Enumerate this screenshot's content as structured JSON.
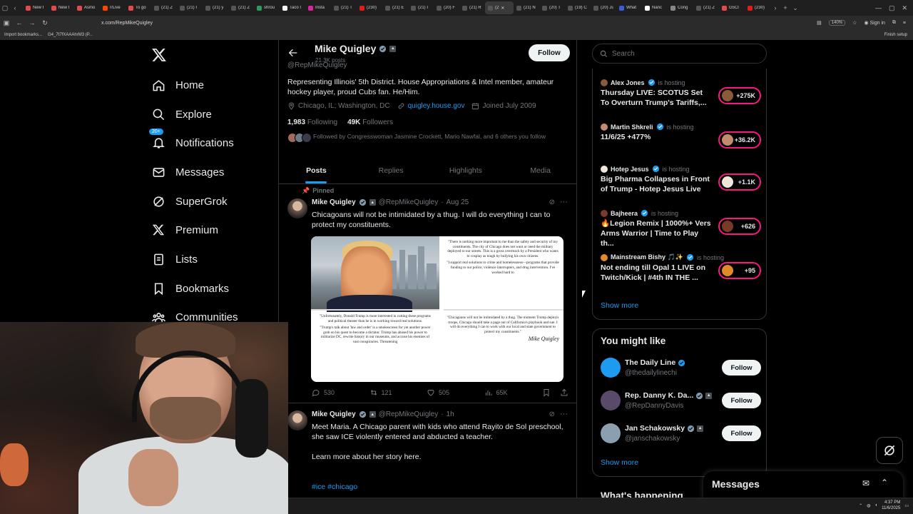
{
  "browser": {
    "tabs": [
      {
        "label": "New t",
        "color": "#e24b4b"
      },
      {
        "label": "New t",
        "color": "#e24b4b"
      },
      {
        "label": "Asmo",
        "color": "#e24b4b"
      },
      {
        "label": "r/Live",
        "color": "#ff4500"
      },
      {
        "label": "To go",
        "color": "#e24b4b"
      },
      {
        "label": "(21) Z",
        "color": "#555555"
      },
      {
        "label": "(21) I",
        "color": "#555555"
      },
      {
        "label": "(21) y",
        "color": "#555555"
      },
      {
        "label": "(21) Z",
        "color": "#555555"
      },
      {
        "label": "shrou",
        "color": "#2b9b5a"
      },
      {
        "label": "Taco I",
        "color": "#ffffff"
      },
      {
        "label": "Insta",
        "color": "#d6249f"
      },
      {
        "label": "(21) T",
        "color": "#555555"
      },
      {
        "label": "(230)",
        "color": "#e21b1b"
      },
      {
        "label": "(21) E",
        "color": "#555555"
      },
      {
        "label": "(21) I",
        "color": "#555555"
      },
      {
        "label": "(20) F",
        "color": "#555555"
      },
      {
        "label": "(21) R",
        "color": "#555555"
      },
      {
        "label": "(2",
        "color": "#555555",
        "active": true
      },
      {
        "label": "(21) N",
        "color": "#555555"
      },
      {
        "label": "(20) T",
        "color": "#555555"
      },
      {
        "label": "(19) C",
        "color": "#555555"
      },
      {
        "label": "(20) Ju",
        "color": "#555555"
      },
      {
        "label": "What",
        "color": "#3b5bdb"
      },
      {
        "label": "Nanc",
        "color": "#ffffff"
      },
      {
        "label": "Cong",
        "color": "#888888"
      },
      {
        "label": "(21) Z",
        "color": "#555555"
      },
      {
        "label": "G5Cl",
        "color": "#e24b4b"
      },
      {
        "label": "(230)",
        "color": "#e21b1b"
      }
    ],
    "url": "x.com/RepMikeQuigley",
    "zoom": "140%",
    "sign_in": "Sign in",
    "bookmarks": [
      "Import bookmarks...",
      "G4_7t7fXAAAhrM3 (P..."
    ],
    "finish_setup": "Finish setup"
  },
  "nav": {
    "items": [
      {
        "label": "Home",
        "icon": "home-icon"
      },
      {
        "label": "Explore",
        "icon": "search-icon"
      },
      {
        "label": "Notifications",
        "icon": "bell-icon",
        "badge": "20+"
      },
      {
        "label": "Messages",
        "icon": "envelope-icon"
      },
      {
        "label": "SuperGrok",
        "icon": "grok-icon"
      },
      {
        "label": "Premium",
        "icon": "x-icon"
      },
      {
        "label": "Lists",
        "icon": "list-icon"
      },
      {
        "label": "Bookmarks",
        "icon": "bookmark-icon"
      },
      {
        "label": "Communities",
        "icon": "communities-icon"
      }
    ]
  },
  "profile": {
    "name": "Mike Quigley",
    "posts_count": "21.3K posts",
    "handle": "@RepMikeQuigley",
    "follow_label": "Follow",
    "bio": "Representing Illinois' 5th District. House Appropriations & Intel member, amateur hockey player, proud Cubs fan. He/Him.",
    "location": "Chicago, IL; Washington, DC",
    "website": "quigley.house.gov",
    "joined": "Joined July 2009",
    "following_count": "1,983",
    "following_label": "Following",
    "followers_count": "49K",
    "followers_label": "Followers",
    "followed_by": "Followed by Congresswoman Jasmine Crockett, Mario Nawfal, and 6 others you follow",
    "tabs": [
      "Posts",
      "Replies",
      "Highlights",
      "Media"
    ]
  },
  "posts": [
    {
      "pinned_label": "Pinned",
      "name": "Mike Quigley",
      "handle": "@RepMikeQuigley",
      "time": "Aug 25",
      "text": "Chicagoans will not be intimidated by a thug. I will do everything I can to protect my constituents.",
      "media_text": {
        "quote1": "\"There is nothing more important to me than the safety and security of my constituents. The city of Chicago does not want or need the military deployed to our streets. This is a gross overreach by a President who wants to cosplay as tough by bullying his own citizens.",
        "quote1b": "\"I support real solutions to crime and homelessness—programs that provide funding to our police, violence interrupters, and drug intervention. I've worked hard to",
        "quote2": "\"Unfortunately, Donald Trump is more interested in cutting these programs and political theater than he is in working toward real solutions.",
        "quote2b": "\"Trump's talk about 'law and order' is a smokescreen for yet another power grab on his quest to become a dictator. Trump has abused his power to militarize DC, rewrite history in our museums, and accuse his enemies of vast conspiracies. Threatening",
        "quote3": "\"Chicagoans will not be intimidated by a thug. The moment Trump deploys troops, Chicago should take a page out of California's playbook and sue. I will do everything I can to work with our local and state government to protect my constituents.\"",
        "signature": "Mike Quigley"
      },
      "replies": "530",
      "reposts": "121",
      "likes": "505",
      "views": "65K"
    },
    {
      "name": "Mike Quigley",
      "handle": "@RepMikeQuigley",
      "time": "1h",
      "text": "Meet Maria. A Chicago parent with kids who attend Rayito de Sol preschool, she saw ICE violently entered and abducted a teacher.",
      "text2": "Learn more about her story here.",
      "hashtags": "#ice #chicago"
    }
  ],
  "search": {
    "placeholder": "Search"
  },
  "spaces": [
    {
      "host": "Alex Jones",
      "hosting": "is hosting",
      "title": "Thursday LIVE: SCOTUS Set To Overturn Trump's Tariffs,...",
      "count": "+275K",
      "color": "#8a5a3a"
    },
    {
      "host": "Martin Shkreli",
      "hosting": "is hosting",
      "title": "11/6/25 +477%",
      "count": "+36.2K",
      "color": "#c28d6e"
    },
    {
      "host": "Hotep Jesus",
      "hosting": "is hosting",
      "title": "Big Pharma Collapses in Front of Trump - Hotep Jesus Live",
      "count": "+1.1K",
      "color": "#f0e6dc"
    },
    {
      "host": "Bajheera",
      "hosting": "is hosting",
      "title": "🔥Legion Remix | 1000%+ Vers Arms Warrior | Time to Play th...",
      "count": "+626",
      "color": "#7a3a2a"
    },
    {
      "host": "Mainstream Bishy 🎵✨",
      "hosting": "is hosting",
      "title": "Not ending till Opal 1 LIVE on Twitch/Kick | #4th IN THE ...",
      "count": "+95",
      "color": "#e08a2a"
    }
  ],
  "spaces_show_more": "Show more",
  "you_might_like": {
    "title": "You might like",
    "accounts": [
      {
        "name": "The Daily Line",
        "handle": "@thedailylinechi",
        "color": "#1d9bf0",
        "follow": "Follow"
      },
      {
        "name": "Rep. Danny K. Da...",
        "handle": "@RepDannyDavis",
        "color": "#5a4a6a",
        "follow": "Follow"
      },
      {
        "name": "Jan Schakowsky",
        "handle": "@janschakowsky",
        "color": "#8aa0b0",
        "follow": "Follow"
      }
    ],
    "show_more": "Show more"
  },
  "whats_happening": "What's happening",
  "messages_dock": {
    "title": "Messages"
  },
  "clock": {
    "time": "4:37 PM",
    "date": "11/6/2025"
  },
  "colors": {
    "accent": "#1d9bf0",
    "live": "#f91880",
    "bg": "#000000",
    "border": "#2f3336",
    "muted": "#71767b"
  }
}
